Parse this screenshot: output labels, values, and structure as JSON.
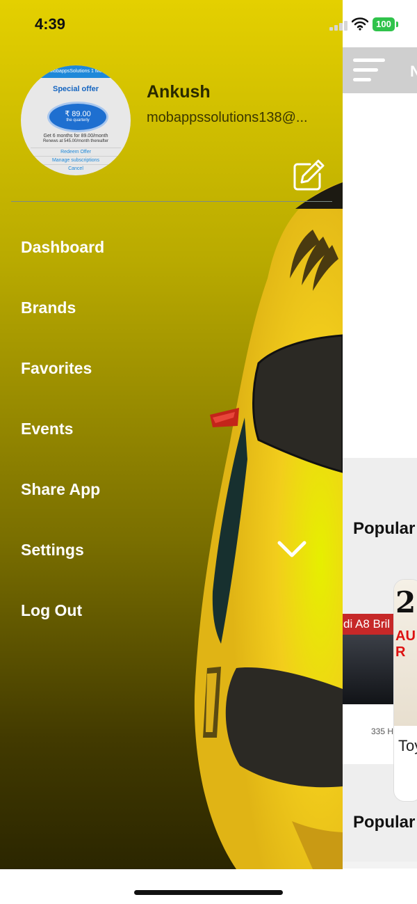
{
  "status_bar": {
    "time": "4:39",
    "battery": "100"
  },
  "background_app": {
    "nav_text": "N",
    "section_1": "Popular",
    "section_2": "Popular",
    "card_1": {
      "header": "di A8 Bril",
      "meta": "335 H"
    },
    "card_2": {
      "big_text": "2",
      "red_text": "AU",
      "red_text_2": "R",
      "label": "Toy"
    }
  },
  "drawer": {
    "profile": {
      "name": "Ankush",
      "email": "mobappssolutions138@...",
      "photo": {
        "top_bar": "MobappsSolutions 1 Mo",
        "title": "Special offer",
        "price": "₹ 89.00",
        "price_sub": "the quarterly",
        "line_1": "Get 6 months for 89.00/month",
        "line_2": "Renews at 545.00/month thereafter",
        "btn_1": "Redeem Offer",
        "btn_2": "Manage subscriptions",
        "btn_3": "Cancel"
      }
    },
    "menu": [
      {
        "label": "Dashboard"
      },
      {
        "label": "Brands"
      },
      {
        "label": "Favorites"
      },
      {
        "label": "Events"
      },
      {
        "label": "Share App"
      },
      {
        "label": "Settings"
      },
      {
        "label": "Log Out"
      }
    ],
    "icons": {
      "edit": "edit-icon",
      "settings_expand": "chevron-down-icon"
    }
  },
  "colors": {
    "drawer_top": "#e4d000",
    "drawer_bottom": "#2b2600",
    "battery": "#30c34b",
    "menu_text": "#ffffff"
  }
}
